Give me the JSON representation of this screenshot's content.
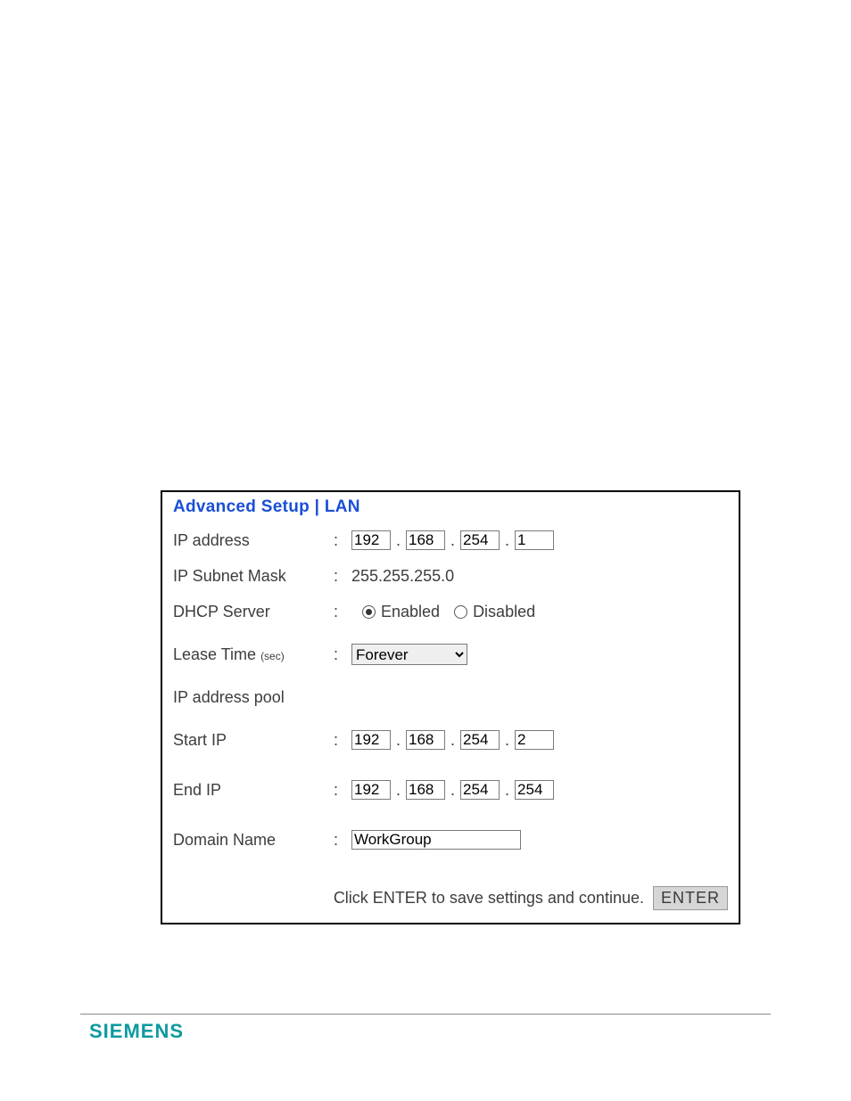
{
  "panel": {
    "title": "Advanced Setup | LAN",
    "ip_address": {
      "label": "IP address",
      "octets": [
        "192",
        "168",
        "254",
        "1"
      ]
    },
    "subnet": {
      "label": "IP Subnet Mask",
      "value": "255.255.255.0"
    },
    "dhcp": {
      "label": "DHCP Server",
      "enabled_label": "Enabled",
      "disabled_label": "Disabled",
      "selected": "enabled"
    },
    "lease": {
      "label_main": "Lease Time ",
      "label_sub": "(sec)",
      "selected": "Forever"
    },
    "pool_label": "IP address pool",
    "start_ip": {
      "label": "Start IP",
      "octets": [
        "192",
        "168",
        "254",
        "2"
      ]
    },
    "end_ip": {
      "label": "End IP",
      "octets": [
        "192",
        "168",
        "254",
        "254"
      ]
    },
    "domain": {
      "label": "Domain Name",
      "value": "WorkGroup"
    },
    "footer_hint": "Click ENTER to save settings and continue.",
    "enter_label": "ENTER"
  },
  "brand": "SIEMENS",
  "colon": ":",
  "dot": "."
}
